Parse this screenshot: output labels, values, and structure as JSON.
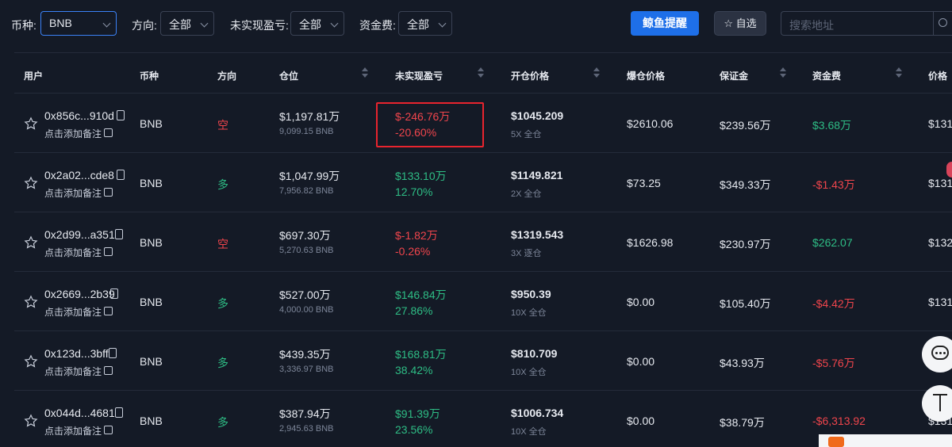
{
  "filters": {
    "coin": {
      "label": "币种:",
      "value": "BNB"
    },
    "direction": {
      "label": "方向:",
      "value": "全部"
    },
    "pnl": {
      "label": "未实现盈亏:",
      "value": "全部"
    },
    "funding": {
      "label": "资金费:",
      "value": "全部"
    },
    "alert_button": "鲸鱼提醒",
    "favorites_button": "自选",
    "search_placeholder": "搜索地址"
  },
  "columns": [
    "用户",
    "币种",
    "方向",
    "仓位",
    "未实现盈亏",
    "开仓价格",
    "爆仓价格",
    "保证金",
    "资金费",
    "价格"
  ],
  "rows": [
    {
      "address": "0x856c...910d",
      "note": "点击添加备注",
      "coin": "BNB",
      "direction": "空",
      "position": "$1,197.81万",
      "position_sub": "9,099.15 BNB",
      "pnl": "$-246.76万",
      "pnl_pct": "-20.60%",
      "open_price": "$1045.209",
      "leverage": "5X 全仓",
      "liq_price": "$2610.06",
      "margin": "$239.56万",
      "funding": "$3.68万",
      "price": "$131"
    },
    {
      "address": "0x2a02...cde8",
      "note": "点击添加备注",
      "coin": "BNB",
      "direction": "多",
      "position": "$1,047.99万",
      "position_sub": "7,956.82 BNB",
      "pnl": "$133.10万",
      "pnl_pct": "12.70%",
      "open_price": "$1149.821",
      "leverage": "2X 全仓",
      "liq_price": "$73.25",
      "margin": "$349.33万",
      "funding": "-$1.43万",
      "price": "$131"
    },
    {
      "address": "0x2d99...a351",
      "note": "点击添加备注",
      "coin": "BNB",
      "direction": "空",
      "position": "$697.30万",
      "position_sub": "5,270.63 BNB",
      "pnl": "$-1.82万",
      "pnl_pct": "-0.26%",
      "open_price": "$1319.543",
      "leverage": "3X 逐仓",
      "liq_price": "$1626.98",
      "margin": "$230.97万",
      "funding": "$262.07",
      "price": "$132"
    },
    {
      "address": "0x2669...2b39",
      "note": "点击添加备注",
      "coin": "BNB",
      "direction": "多",
      "position": "$527.00万",
      "position_sub": "4,000.00 BNB",
      "pnl": "$146.84万",
      "pnl_pct": "27.86%",
      "open_price": "$950.39",
      "leverage": "10X 全仓",
      "liq_price": "$0.00",
      "margin": "$105.40万",
      "funding": "-$4.42万",
      "price": "$131"
    },
    {
      "address": "0x123d...3bff",
      "note": "点击添加备注",
      "coin": "BNB",
      "direction": "多",
      "position": "$439.35万",
      "position_sub": "3,336.97 BNB",
      "pnl": "$168.81万",
      "pnl_pct": "38.42%",
      "open_price": "$810.709",
      "leverage": "10X 全仓",
      "liq_price": "$0.00",
      "margin": "$43.93万",
      "funding": "-$5.76万",
      "price": "$131"
    },
    {
      "address": "0x044d...4681",
      "note": "点击添加备注",
      "coin": "BNB",
      "direction": "多",
      "position": "$387.94万",
      "position_sub": "2,945.63 BNB",
      "pnl": "$91.39万",
      "pnl_pct": "23.56%",
      "open_price": "$1006.734",
      "leverage": "10X 全仓",
      "liq_price": "$0.00",
      "margin": "$38.79万",
      "funding": "-$6,313.92",
      "price": "$131"
    }
  ],
  "colors": {
    "background": "#141a26",
    "accent": "#1e6fe8",
    "profit": "#2ebd85",
    "loss": "#f0454c",
    "highlight": "#e8242e"
  }
}
